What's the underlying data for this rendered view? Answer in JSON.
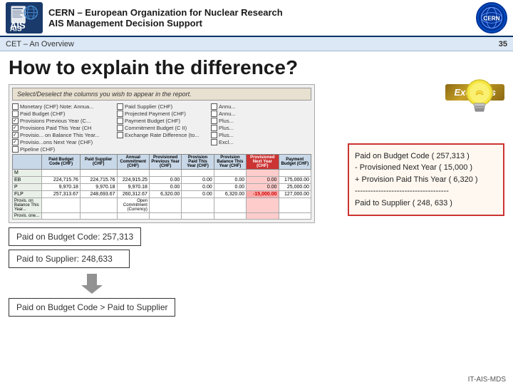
{
  "header": {
    "org_name": "CERN – European Organization for Nuclear Research",
    "system_name": "AIS Management Decision Support",
    "ais_label": "AIS",
    "cern_label": "CERN"
  },
  "topbar": {
    "section": "CET – An Overview",
    "page_number": "35"
  },
  "page": {
    "title": "How to explain the difference?"
  },
  "dialog": {
    "instruction": "Select/Deselect the columns you wish to appear in the report."
  },
  "checkboxes": {
    "col1": [
      {
        "label": "Monetary (CHF)",
        "checked": false
      },
      {
        "label": "Paid Budget (CHF)",
        "checked": false
      },
      {
        "label": "Provisions Previous Year (C...",
        "checked": true
      },
      {
        "label": "Provisions Paid This Year (CH",
        "checked": true
      },
      {
        "label": "Provisio... on Balance This Year...",
        "checked": true
      },
      {
        "label": "Provisio...ons Next Year (CHF)",
        "checked": true
      },
      {
        "label": "Pipeline (CHF)",
        "checked": false
      }
    ],
    "col2": [
      {
        "label": "Paid Supplier (CHF)",
        "checked": false
      },
      {
        "label": "Projected Payment (CHF)",
        "checked": false
      },
      {
        "label": "Payment Budget (CHF)",
        "checked": false
      },
      {
        "label": "Commitment Budget (C II)",
        "checked": false
      },
      {
        "label": "Exchange Rate Difference (to...",
        "checked": false
      }
    ]
  },
  "mini_table": {
    "headers": [
      "",
      "Paid Budget Code (CHF)",
      "Paid Supplier (CHF)",
      "Annual Commitment (CHF)",
      "Provisioned Previous Year (CHF)",
      "Provision Paid This Year (CHF)",
      "Provision Balance This Year (CHF)",
      "Provisioned Next Year (CHF)",
      "Payment Budget (CHF)"
    ],
    "rows": [
      {
        "label": "M",
        "cols": [
          "",
          "",
          "",
          "",
          "",
          "",
          "",
          ""
        ]
      },
      {
        "label": "EB",
        "cols": [
          "224,715.76",
          "224,715.76",
          "224,915.25",
          "0.00",
          "0.00",
          "0.00",
          "0.00",
          "175,000.00"
        ]
      },
      {
        "label": "P",
        "cols": [
          "9,970.18",
          "9,970.18",
          "9,970.18",
          "0.00",
          "0.00",
          "0.00",
          "0.00",
          "25,000.00"
        ]
      },
      {
        "label": "FLP",
        "cols": [
          "257,313.67",
          "248,693.67",
          "260,312.67",
          "6,320.00",
          "0.00",
          "6,320.00",
          "-15,000.00",
          "127,000.00"
        ]
      },
      {
        "label": "Provis. on Balance This Year...",
        "cols": [
          "",
          "",
          "",
          "",
          "",
          "",
          "",
          ""
        ]
      },
      {
        "label": "Provis. one...",
        "cols": [
          "",
          "",
          "",
          "",
          "",
          "",
          "",
          ""
        ]
      }
    ]
  },
  "info_boxes": {
    "box1_label": "Paid on Budget Code: 257,313",
    "box2_label": "Paid to Supplier: 248,633",
    "result_label": "Paid on Budget Code > Paid to Supplier"
  },
  "right_panel": {
    "excursus_label": "Excursus",
    "explanation_lines": [
      "Paid on Budget Code ( 257,313 )",
      "- Provisioned Next Year ( 15,000 )",
      "+ Provision Paid This Year ( 6,320 )",
      "------------------------------------",
      "Paid to Supplier ( 248, 633 )"
    ]
  },
  "footer": {
    "label": "IT-AIS-MDS"
  }
}
